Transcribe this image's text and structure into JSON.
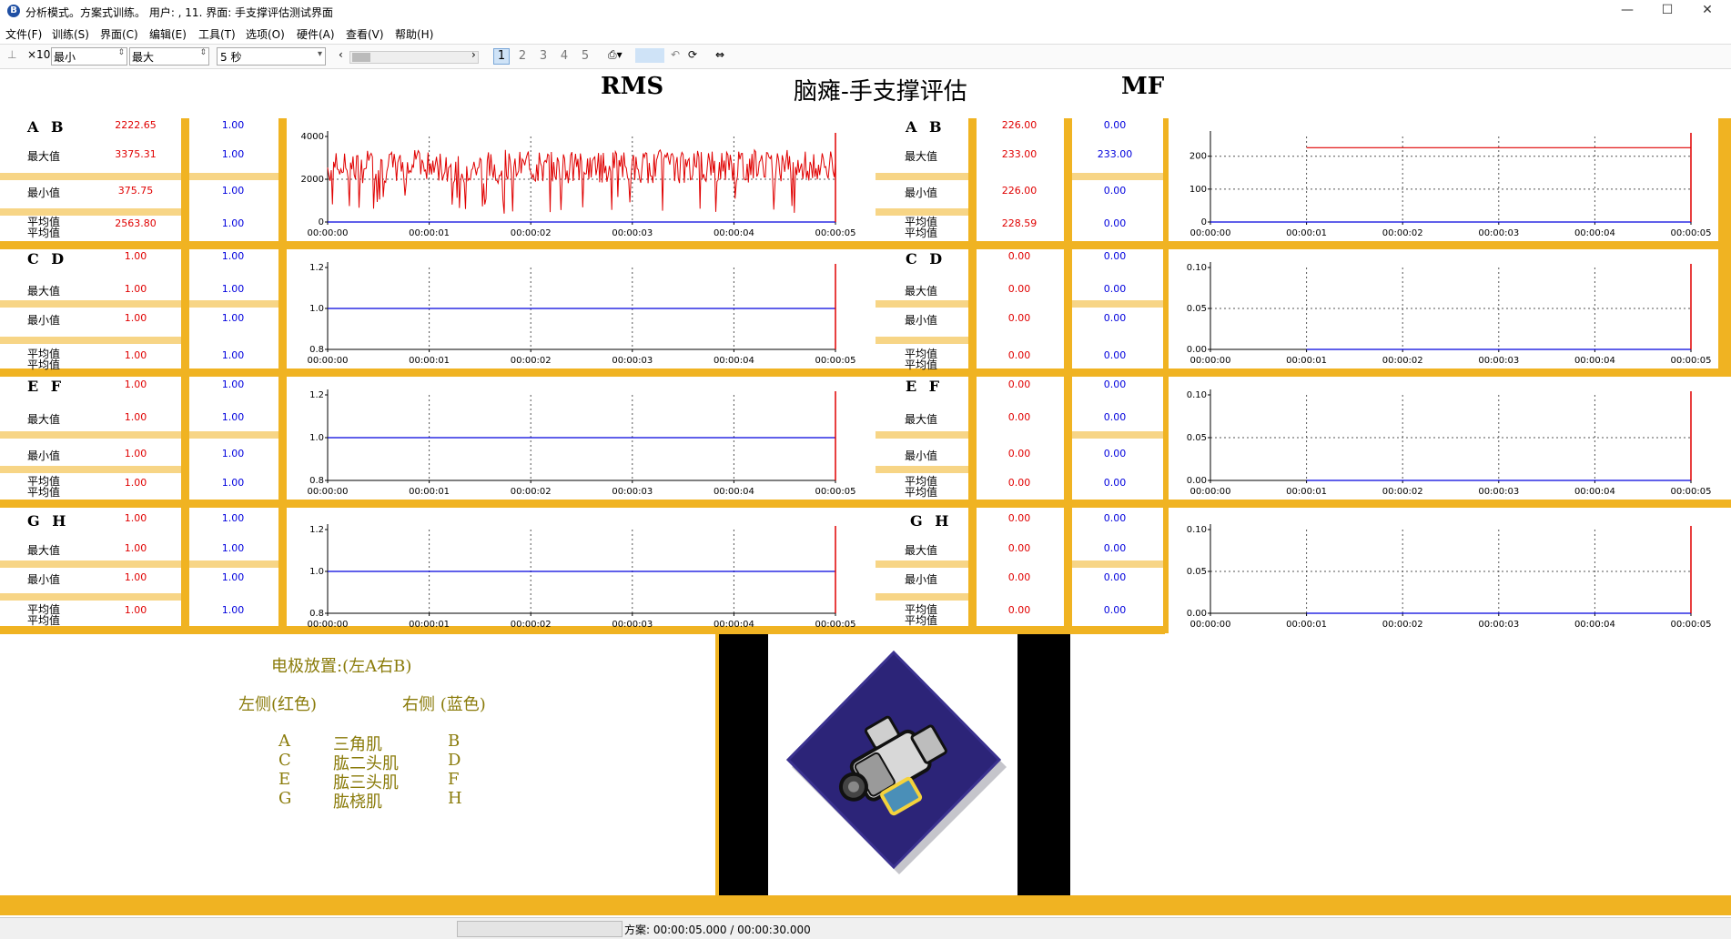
{
  "window": {
    "title": "分析模式。方案式训练。 用户: , 11. 界面: 手支撑评估测试界面",
    "icon_label": "B",
    "controls": {
      "minimize": "—",
      "maximize": "☐",
      "close": "✕"
    }
  },
  "menu": [
    "文件(F)",
    "训练(S)",
    "界面(C)",
    "编辑(E)",
    "工具(T)",
    "选项(O)",
    "硬件(A)",
    "查看(V)",
    "帮助(H)"
  ],
  "toolbar": {
    "scale_label": "×10",
    "min_label": "最小",
    "max_label": "最大",
    "time_window": "5 秒",
    "pages": [
      "1",
      "2",
      "3",
      "4",
      "5"
    ],
    "active_page": "1"
  },
  "headings": {
    "rms": "RMS",
    "main": "脑瘫-手支撑评估",
    "mf": "MF"
  },
  "stat_labels": {
    "max": "最大值",
    "min": "最小值",
    "avg_line1": "平均值",
    "avg_line2": "平均值"
  },
  "rms_panels": [
    {
      "channel": "A B",
      "left": {
        "cur": "2222.65",
        "max": "3375.31",
        "min": "375.75",
        "avg": "2563.80"
      },
      "right": {
        "cur": "1.00",
        "max": "1.00",
        "min": "1.00",
        "avg": "1.00"
      }
    },
    {
      "channel": "C D",
      "left": {
        "cur": "1.00",
        "max": "1.00",
        "min": "1.00",
        "avg": "1.00"
      },
      "right": {
        "cur": "1.00",
        "max": "1.00",
        "min": "1.00",
        "avg": "1.00"
      }
    },
    {
      "channel": "E F",
      "left": {
        "cur": "1.00",
        "max": "1.00",
        "min": "1.00",
        "avg": "1.00"
      },
      "right": {
        "cur": "1.00",
        "max": "1.00",
        "min": "1.00",
        "avg": "1.00"
      }
    },
    {
      "channel": "G H",
      "left": {
        "cur": "1.00",
        "max": "1.00",
        "min": "1.00",
        "avg": "1.00"
      },
      "right": {
        "cur": "1.00",
        "max": "1.00",
        "min": "1.00",
        "avg": "1.00"
      }
    }
  ],
  "mf_panels": [
    {
      "channel": "A B",
      "left": {
        "cur": "226.00",
        "max": "233.00",
        "min": "226.00",
        "avg": "228.59"
      },
      "right": {
        "cur": "0.00",
        "max": "233.00",
        "min": "0.00",
        "avg": "0.00"
      }
    },
    {
      "channel": "C D",
      "left": {
        "cur": "0.00",
        "max": "0.00",
        "min": "0.00",
        "avg": "0.00"
      },
      "right": {
        "cur": "0.00",
        "max": "0.00",
        "min": "0.00",
        "avg": "0.00"
      }
    },
    {
      "channel": "E F",
      "left": {
        "cur": "0.00",
        "max": "0.00",
        "min": "0.00",
        "avg": "0.00"
      },
      "right": {
        "cur": "0.00",
        "max": "0.00",
        "min": "0.00",
        "avg": "0.00"
      }
    },
    {
      "channel": "G H",
      "left": {
        "cur": "0.00",
        "max": "0.00",
        "min": "0.00",
        "avg": "0.00"
      },
      "right": {
        "cur": "0.00",
        "max": "0.00",
        "min": "0.00",
        "avg": "0.00"
      }
    }
  ],
  "chart_data": [
    {
      "type": "line",
      "x_ticks": [
        "00:00:00",
        "00:00:01",
        "00:00:02",
        "00:00:03",
        "00:00:04",
        "00:00:05"
      ],
      "y_ticks": [
        "0",
        "2000",
        "4000"
      ],
      "ylim": [
        0,
        4000
      ],
      "series": [
        {
          "color": "#e00000",
          "style": "noisy",
          "mean": 2560,
          "min": 375.75,
          "max": 3375.31
        },
        {
          "color": "#0000dd",
          "value": 0
        }
      ]
    },
    {
      "type": "line",
      "x_ticks": [
        "00:00:00",
        "00:00:01",
        "00:00:02",
        "00:00:03",
        "00:00:04",
        "00:00:05"
      ],
      "y_ticks": [
        "0.8",
        "1.0",
        "1.2"
      ],
      "ylim": [
        0.8,
        1.2
      ],
      "series": [
        {
          "color": "#0000dd",
          "value": 1.0
        }
      ]
    },
    {
      "type": "line",
      "x_ticks": [
        "00:00:00",
        "00:00:01",
        "00:00:02",
        "00:00:03",
        "00:00:04",
        "00:00:05"
      ],
      "y_ticks": [
        "0.8",
        "1.0",
        "1.2"
      ],
      "ylim": [
        0.8,
        1.2
      ],
      "series": [
        {
          "color": "#0000dd",
          "value": 1.0
        }
      ]
    },
    {
      "type": "line",
      "x_ticks": [
        "00:00:00",
        "00:00:01",
        "00:00:02",
        "00:00:03",
        "00:00:04",
        "00:00:05"
      ],
      "y_ticks": [
        "0.8",
        "1.0",
        "1.2"
      ],
      "ylim": [
        0.8,
        1.2
      ],
      "series": [
        {
          "color": "#0000dd",
          "value": 1.0
        }
      ]
    },
    {
      "type": "line",
      "x_ticks": [
        "00:00:00",
        "00:00:01",
        "00:00:02",
        "00:00:03",
        "00:00:04",
        "00:00:05"
      ],
      "y_ticks": [
        "0",
        "100",
        "200"
      ],
      "ylim": [
        0,
        260
      ],
      "series": [
        {
          "color": "#e00000",
          "value": 226,
          "start": 1
        },
        {
          "color": "#0000dd",
          "value": 0
        }
      ]
    },
    {
      "type": "line",
      "x_ticks": [
        "00:00:00",
        "00:00:01",
        "00:00:02",
        "00:00:03",
        "00:00:04",
        "00:00:05"
      ],
      "y_ticks": [
        "0.00",
        "0.05",
        "0.10"
      ],
      "ylim": [
        0,
        0.1
      ],
      "series": [
        {
          "color": "#0000dd",
          "value": 0,
          "start": 1
        }
      ]
    },
    {
      "type": "line",
      "x_ticks": [
        "00:00:00",
        "00:00:01",
        "00:00:02",
        "00:00:03",
        "00:00:04",
        "00:00:05"
      ],
      "y_ticks": [
        "0.00",
        "0.05",
        "0.10"
      ],
      "ylim": [
        0,
        0.1
      ],
      "series": [
        {
          "color": "#0000dd",
          "value": 0,
          "start": 1
        }
      ]
    },
    {
      "type": "line",
      "x_ticks": [
        "00:00:00",
        "00:00:01",
        "00:00:02",
        "00:00:03",
        "00:00:04",
        "00:00:05"
      ],
      "y_ticks": [
        "0.00",
        "0.05",
        "0.10"
      ],
      "ylim": [
        0,
        0.1
      ],
      "series": [
        {
          "color": "#0000dd",
          "value": 0,
          "start": 1
        }
      ]
    }
  ],
  "legend": {
    "title": "电极放置:(左A右B)",
    "left_header": "左侧(红色)",
    "right_header": "右侧 (蓝色)",
    "rows": [
      {
        "l": "A",
        "muscle": "三角肌",
        "r": "B"
      },
      {
        "l": "C",
        "muscle": "肱二头肌",
        "r": "D"
      },
      {
        "l": "E",
        "muscle": "肱三头肌",
        "r": "F"
      },
      {
        "l": "G",
        "muscle": "肱桡肌",
        "r": "H"
      }
    ]
  },
  "image": {
    "icon": "video-camera-icon"
  },
  "status": {
    "text": "方案: 00:00:05.000 / 00:00:30.000"
  },
  "colors": {
    "accent": "#f0b322",
    "left_series": "#e00000",
    "right_series": "#0000dd",
    "legend_text": "#8a7b0a"
  }
}
